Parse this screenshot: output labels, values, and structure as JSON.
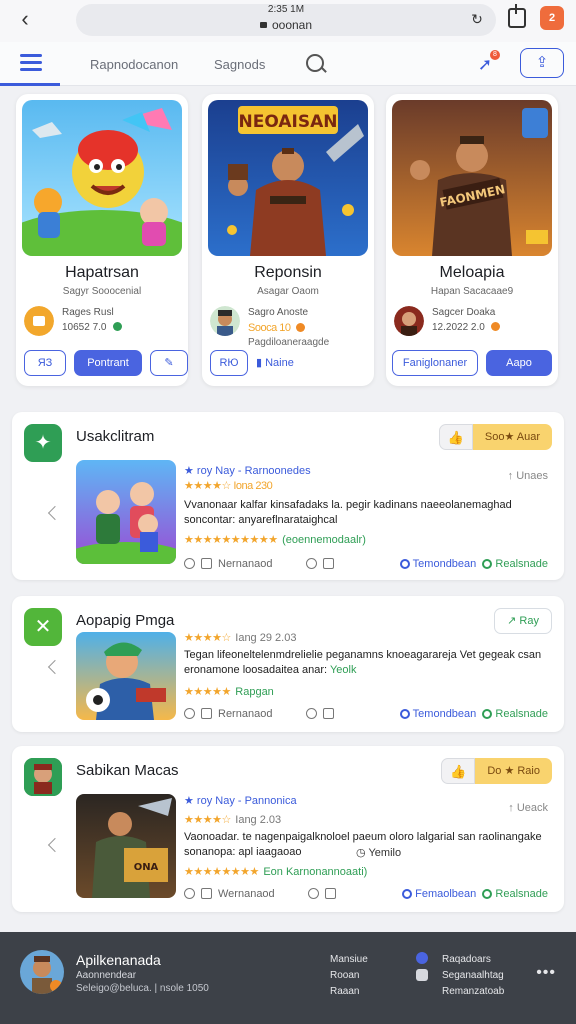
{
  "browser": {
    "time": "2:35 1M",
    "address": "ooonan",
    "tab_count": "2"
  },
  "nav": {
    "tab1": "Rapnodocanon",
    "tab2": "Sagnods",
    "notif_count": "8"
  },
  "featured": [
    {
      "title": "Hapatrsan",
      "subtitle": "Sagyr Sooocenial",
      "meta1": "Rages Rusl",
      "meta2": "10652 7.0",
      "btn1": "ЯЗ",
      "btn2": "Pontrant",
      "btn3": "✎",
      "badge_color": "#2f9e55"
    },
    {
      "title": "Reponsin",
      "subtitle": "Asagar Oaom",
      "meta1": "Sagro Anoste",
      "meta2": "Sooca 10",
      "extra": "Pagdiloaneraagde",
      "btn1": "RЮ",
      "btn2": "Naine",
      "badge_color": "#ef8a25",
      "art_text": "NEOAISAN"
    },
    {
      "title": "Meloapia",
      "subtitle": "Hapan Sacacaae9",
      "meta1": "Sagcer Doaka",
      "meta2": "12.2022 2.0",
      "btn1": "Faniglonaner",
      "btn2": "Aapo",
      "badge_color": "#ef8a25",
      "art_text": "FAONMEN"
    }
  ],
  "list": [
    {
      "title": "Usakclitram",
      "action": "Soo★ Auar",
      "tag": "★ roy Nay - Rarnoonedes",
      "right": "Unaes",
      "rating_text": "★★★★☆ Iona 230",
      "desc": "Vvanonaar kalfar kinsafadaks la. pegir kadinans naeeolanemaghad soncontar: anyareflnarataighcal",
      "stars": "★★★★★★★★★★",
      "green": "(eoennemodaalr)",
      "foot_left": "Nernanaod",
      "link1": "Temondbean",
      "link2": "Realsnade",
      "icon_color": "#2f9e55"
    },
    {
      "title": "Aopapig Pmga",
      "action": "↗ Ray",
      "rating": "★★★★☆",
      "rating_text": "Iang 29 2.03",
      "desc": "Tegan lifeoneltelenmdrelielie peganamns knoeagarareja Vet gegeak csan eronamone loosadaitea anar:",
      "green_inline": "Yeolk",
      "stars": "★★★★★",
      "grey": "Rapgan",
      "foot_left": "Rernanaod",
      "link1": "Temondbean",
      "link2": "Realsnade",
      "icon_color": "#52b63a"
    },
    {
      "title": "Sabikan Macas",
      "action": "Do ★ Raio",
      "tag": "★ roy Nay - Pannonica",
      "right": "Ueack",
      "rating": "★★★★☆",
      "rating_text": "Iang 2.03",
      "desc": "Vaonoadar. te nagenpaigalknoloel paeum oloro lalgarial san raolinangake sonanopa: apl iaagaoao",
      "desc_right": "◷ Yemilo",
      "stars": "★★★★★★★★",
      "green": "Eon Karnonannoaati)",
      "foot_left": "Wernanaod",
      "link1": "Femaolbean",
      "link2": "Realsnade",
      "icon_color": "#2f9e55"
    }
  ],
  "bottom": {
    "name": "Apilkenanada",
    "sub1": "Aaonnendear",
    "sub2": "Seleigo@beluca. | nsole 1050",
    "col1": [
      "Mansiue",
      "Rooan",
      "Raaan"
    ],
    "col2": [
      "Raqadoars",
      "Seganaalhtag",
      "Remanzatoab"
    ],
    "more": "•••"
  },
  "colors": {
    "accent": "#3b5bdb",
    "green": "#2f9e55",
    "yellow": "#f9d36e",
    "bottom_bar": "#3d4148"
  }
}
